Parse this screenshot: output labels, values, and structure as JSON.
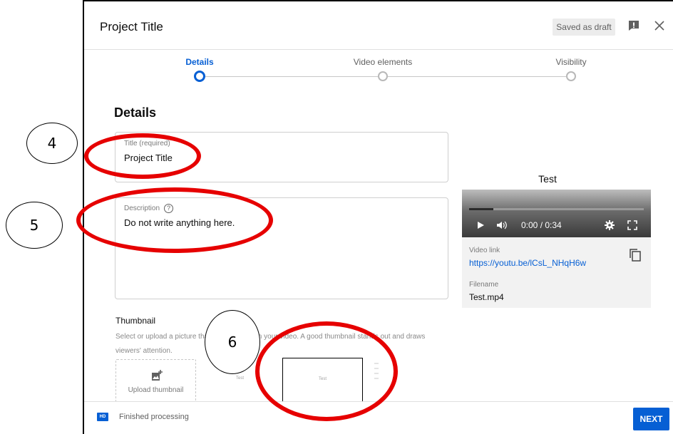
{
  "header": {
    "title": "Project Title",
    "draft_badge": "Saved as draft"
  },
  "stepper": {
    "steps": [
      {
        "label": "Details",
        "active": true
      },
      {
        "label": "Video elements",
        "active": false
      },
      {
        "label": "Visibility",
        "active": false
      }
    ]
  },
  "details": {
    "heading": "Details",
    "title_field": {
      "label": "Title (required)",
      "value": "Project Title"
    },
    "description_field": {
      "label": "Description",
      "help": "?",
      "value": "Do not write anything here."
    }
  },
  "preview": {
    "title": "Test",
    "time": "0:00 / 0:34",
    "progress": 0.14,
    "video_link_label": "Video link",
    "video_link": "https://youtu.be/lCsL_NHqH6w",
    "filename_label": "Filename",
    "filename": "Test.mp4"
  },
  "thumbnail": {
    "heading": "Thumbnail",
    "description": "Select or upload a picture that shows what's in your video. A good thumbnail stands out and draws viewers' attention.",
    "upload_label": "Upload thumbnail",
    "options": [
      "Test",
      "Test"
    ]
  },
  "footer": {
    "hd_badge": "HD",
    "status": "Finished processing",
    "next_label": "NEXT"
  },
  "annotations": {
    "markers": [
      "4",
      "5",
      "6"
    ],
    "color": "#e60000"
  },
  "colors": {
    "accent": "#065fd4"
  }
}
